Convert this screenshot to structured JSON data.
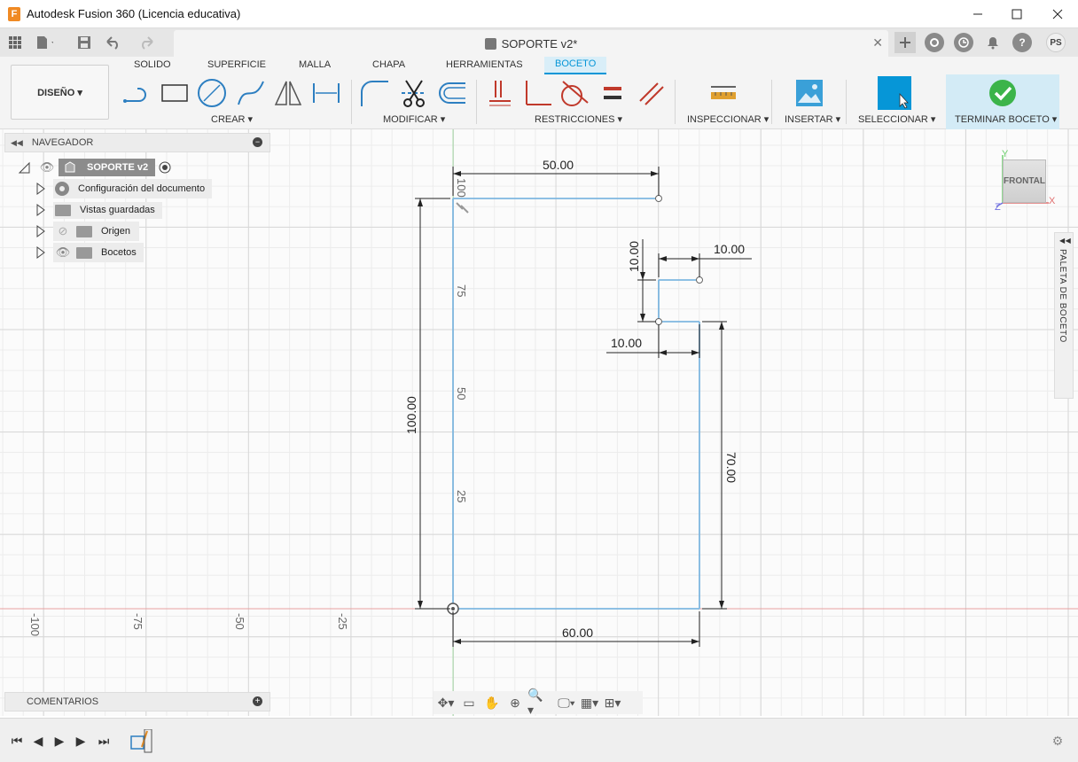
{
  "window": {
    "app_logo": "F",
    "title": "Autodesk Fusion 360 (Licencia educativa)",
    "minimize_icon": "minimize-icon",
    "maximize_icon": "maximize-icon",
    "close_icon": "close-icon"
  },
  "document_tab": {
    "title": "SOPORTE v2*"
  },
  "user": {
    "initials": "PS"
  },
  "ribbon": {
    "workspace": "DISEÑO ▾",
    "tabs": [
      "SOLIDO",
      "SUPERFICIE",
      "MALLA",
      "CHAPA",
      "HERRAMIENTAS",
      "BOCETO"
    ],
    "active_tab": "BOCETO",
    "groups": {
      "crear": "CREAR ▾",
      "modificar": "MODIFICAR ▾",
      "restricciones": "RESTRICCIONES ▾",
      "inspeccionar": "INSPECCIONAR ▾",
      "insertar": "INSERTAR ▾",
      "seleccionar": "SELECCIONAR ▾",
      "terminar": "TERMINAR BOCETO ▾"
    }
  },
  "browser": {
    "title": "NAVEGADOR",
    "root": "SOPORTE v2",
    "items": [
      {
        "label": "Configuración del documento"
      },
      {
        "label": "Vistas guardadas"
      },
      {
        "label": "Origen"
      },
      {
        "label": "Bocetos"
      }
    ]
  },
  "comments": {
    "title": "COMENTARIOS"
  },
  "palette": {
    "label": "PALETA DE BOCETO"
  },
  "viewcube": {
    "face": "FRONTAL",
    "axis_y": "Y",
    "axis_x": "X",
    "axis_z": "Z"
  },
  "sketch": {
    "dimensions": {
      "top_width": "50.00",
      "notch_height": "10.00",
      "notch_width": "10.00",
      "step_width": "10.00",
      "total_height": "100.00",
      "right_height": "70.00",
      "bottom_width": "60.00"
    },
    "y_axis_ticks": [
      "100",
      "75",
      "50",
      "25"
    ],
    "x_axis_ticks": [
      "-100",
      "-75",
      "-50",
      "-25"
    ]
  },
  "colors": {
    "sketch_line": "#7fb7e0",
    "x_axis": "#e8a0a0",
    "y_axis": "#a8dca8",
    "accent": "#0696d7"
  }
}
